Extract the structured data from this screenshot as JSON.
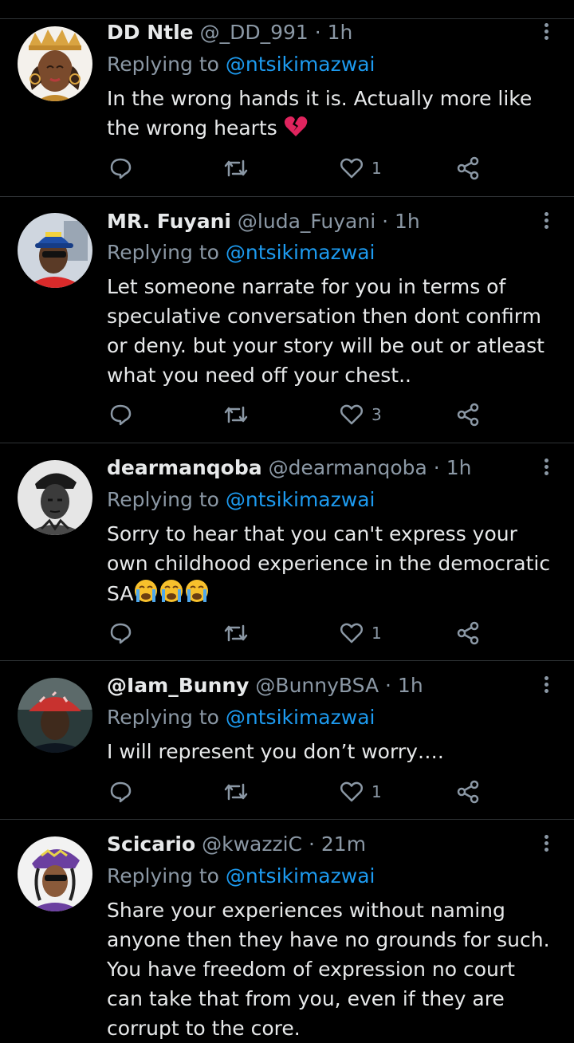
{
  "colors": {
    "background": "#000000",
    "text": "#e7e9ea",
    "muted": "#8b98a5",
    "link": "#1d9bf0",
    "divider": "#2f3336"
  },
  "tweets": [
    {
      "name": "DD Ntle",
      "handle": "@_DD_991",
      "dot": "·",
      "time": "1h",
      "reply_prefix": "Replying to",
      "reply_mention": "@ntsikimazwai",
      "text_lines": [
        "In the wrong hands it is. Actually more like",
        "the wrong hearts"
      ],
      "emoji": "broken-heart",
      "replies": "",
      "retweets": "",
      "likes": "1",
      "avatar_icon": "avatar-crowned-woman"
    },
    {
      "name": "MR. Fuyani",
      "handle": "@luda_Fuyani",
      "dot": "·",
      "time": "1h",
      "reply_prefix": "Replying to",
      "reply_mention": "@ntsikimazwai",
      "text_lines": [
        "Let someone narrate for you in terms of",
        "speculative conversation then dont confirm",
        "or deny. but your story will be out or atleast",
        "what you need off your chest.."
      ],
      "replies": "",
      "retweets": "",
      "likes": "3",
      "avatar_icon": "avatar-man-blue-cap"
    },
    {
      "name": "dearmanqoba",
      "handle": "@dearmanqoba",
      "dot": "·",
      "time": "1h",
      "reply_prefix": "Replying to",
      "reply_mention": "@ntsikimazwai",
      "text_lines": [
        "Sorry to hear that you can't express your",
        "own childhood experience in the democratic",
        "SA"
      ],
      "emoji": "crying-face x3",
      "replies": "",
      "retweets": "",
      "likes": "1",
      "avatar_icon": "avatar-man-beret-bw"
    },
    {
      "name": "@Iam_Bunny",
      "handle": "@BunnyBSA",
      "dot": "·",
      "time": "1h",
      "reply_prefix": "Replying to",
      "reply_mention": "@ntsikimazwai",
      "text_lines": [
        "I will represent you don’t worry…."
      ],
      "replies": "",
      "retweets": "",
      "likes": "1",
      "avatar_icon": "avatar-man-bucket-hat"
    },
    {
      "name": "Scicario",
      "handle": "@kwazziC",
      "dot": "·",
      "time": "21m",
      "reply_prefix": "Replying to",
      "reply_mention": "@ntsikimazwai",
      "text_lines": [
        "Share your experiences without naming",
        "anyone then they have no grounds for such.",
        "You have freedom of expression no court",
        "can take that from you, even if they are",
        "corrupt to the core."
      ],
      "replies": "",
      "retweets": "",
      "likes": "",
      "avatar_icon": "avatar-cartoon-purple-hat"
    }
  ]
}
